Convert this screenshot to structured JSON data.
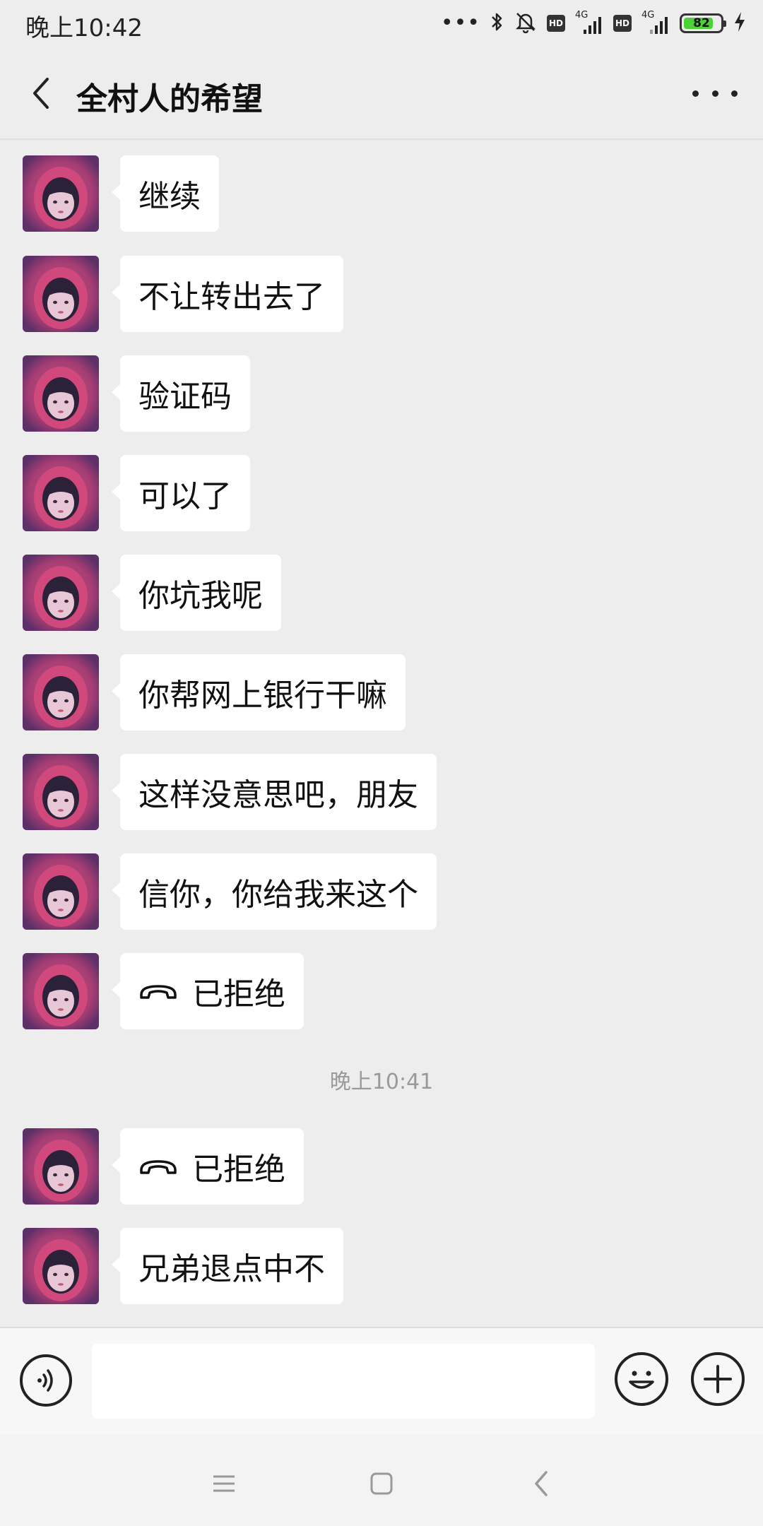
{
  "status_bar": {
    "time": "晚上10:42",
    "hd1": "HD",
    "hd2": "HD",
    "network1": "4G",
    "network2": "4G",
    "battery": "82",
    "battery_level": 0.82
  },
  "header": {
    "title": "全村人的希望"
  },
  "messages": [
    {
      "text": "继续"
    },
    {
      "text": "不让转出去了"
    },
    {
      "text": "验证码"
    },
    {
      "text": "可以了"
    },
    {
      "text": "你坑我呢"
    },
    {
      "text": "你帮网上银行干嘛"
    },
    {
      "text": "这样没意思吧，朋友"
    },
    {
      "text": "信你，你给我来这个"
    },
    {
      "text": "已拒绝",
      "icon": "phone-declined-icon"
    },
    {
      "text": "已拒绝",
      "icon": "phone-declined-icon"
    },
    {
      "text": "兄弟退点中不"
    }
  ],
  "timestamp": "晚上10:41",
  "input": {
    "value": "",
    "placeholder": ""
  },
  "colors": {
    "background": "#ededed",
    "bubble": "#ffffff",
    "battery_green": "#4cd137"
  }
}
